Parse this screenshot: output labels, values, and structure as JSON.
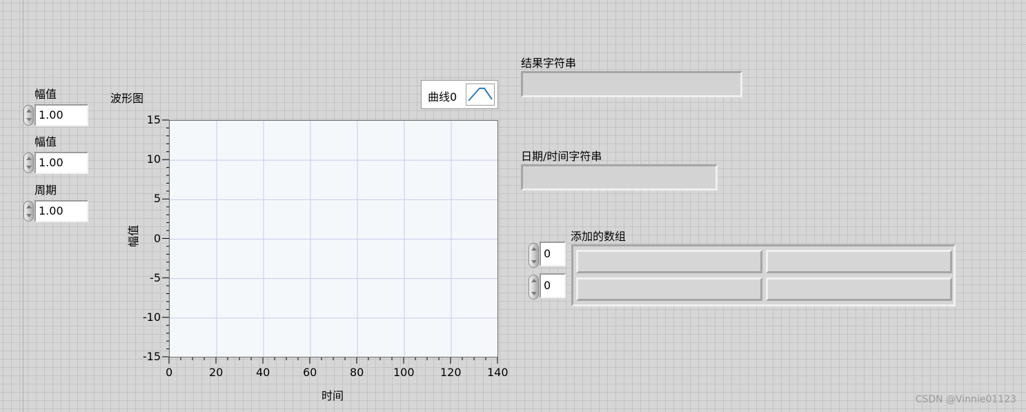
{
  "controls": [
    {
      "label": "幅值",
      "value": "1.00"
    },
    {
      "label": "幅值",
      "value": "1.00"
    },
    {
      "label": "周期",
      "value": "1.00"
    }
  ],
  "graph": {
    "title": "波形图",
    "legend": {
      "name": "曲线0",
      "icon": "triangle-wave-icon"
    },
    "y_axis": {
      "label": "幅值",
      "ticks": [
        "15",
        "10",
        "5",
        "0",
        "-5",
        "-10",
        "-15"
      ]
    },
    "x_axis": {
      "label": "时间",
      "ticks": [
        "0",
        "20",
        "40",
        "60",
        "80",
        "100",
        "120",
        "140"
      ]
    },
    "colors": {
      "grid": "#c8c8ec",
      "plot_bg": "#f4f8fb"
    }
  },
  "chart_data": {
    "type": "line",
    "title": "波形图",
    "xlabel": "时间",
    "ylabel": "幅值",
    "xlim": [
      0,
      140
    ],
    "ylim": [
      -15,
      15
    ],
    "x_ticks": [
      0,
      20,
      40,
      60,
      80,
      100,
      120,
      140
    ],
    "y_ticks": [
      15,
      10,
      5,
      0,
      -5,
      -10,
      -15
    ],
    "grid": true,
    "legend": "top-right",
    "series": [
      {
        "name": "曲线0",
        "values": []
      }
    ]
  },
  "indicators": {
    "result_string": {
      "label": "结果字符串",
      "value": ""
    },
    "datetime_string": {
      "label": "日期/时间字符串",
      "value": ""
    }
  },
  "array": {
    "label": "添加的数组",
    "indices": [
      "0",
      "0"
    ],
    "rows": [
      [
        "",
        ""
      ],
      [
        "",
        ""
      ]
    ]
  },
  "watermark": "CSDN @Vinnie01123"
}
